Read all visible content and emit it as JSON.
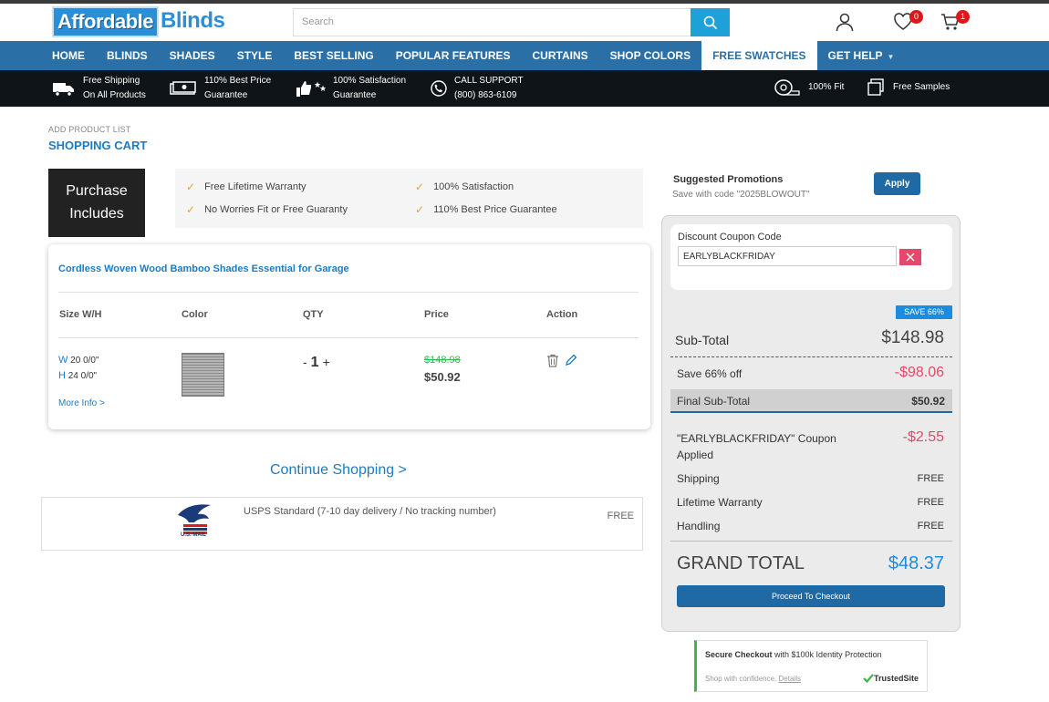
{
  "header": {
    "logo_part1": "Affordable",
    "logo_part2": "Blinds",
    "search_placeholder": "Search",
    "wishlist_count": "0",
    "cart_count": "1"
  },
  "nav": {
    "items": [
      "HOME",
      "BLINDS",
      "SHADES",
      "STYLE",
      "BEST SELLING",
      "POPULAR FEATURES",
      "CURTAINS",
      "SHOP COLORS",
      "FREE SWATCHES",
      "GET HELP"
    ],
    "active": "FREE SWATCHES"
  },
  "benefits": {
    "shipping_1": "Free Shipping",
    "shipping_2": "On All Products",
    "price_1": "110% Best Price",
    "price_2": "Guarantee",
    "satisfaction_1": "100% Satisfaction",
    "satisfaction_2": "Guarantee",
    "support_1": "CALL SUPPORT",
    "support_2": "(800) 863-6109",
    "fit": "100% Fit",
    "samples": "Free Samples"
  },
  "page": {
    "breadcrumb": "ADD PRODUCT LIST",
    "title": "SHOPPING CART",
    "purchase_includes": "Purchase Includes",
    "features": [
      "Free Lifetime Warranty",
      "100% Satisfaction",
      "No Worries Fit or Free Guaranty",
      "110% Best Price Guarantee"
    ]
  },
  "cart": {
    "product_name": "Cordless Woven Wood Bamboo Shades Essential for Garage",
    "headers": [
      "Size W/H",
      "Color",
      "QTY",
      "Price",
      "Action"
    ],
    "width_label": "W",
    "width_value": "20 0/0\"",
    "height_label": "H",
    "height_value": "24 0/0\"",
    "more_info": "More Info >",
    "qty_minus": "-",
    "qty": "1",
    "qty_plus": "+",
    "old_price": "$148.98",
    "new_price": "$50.92"
  },
  "continue_shopping": "Continue Shopping >",
  "shipping_option": {
    "label": "USPS Standard (7-10 day delivery / No tracking number)",
    "price": "FREE",
    "logo_text": "U.S. MAIL"
  },
  "promo": {
    "title": "Suggested Promotions",
    "subtitle": "Save with code \"2025BLOWOUT\"",
    "apply": "Apply"
  },
  "summary": {
    "coupon_label": "Discount Coupon Code",
    "coupon_value": "EARLYBLACKFRIDAY",
    "save_badge": "SAVE 66%",
    "subtotal_label": "Sub-Total",
    "subtotal": "$148.98",
    "save_label": "Save 66% off",
    "save_value": "-$98.06",
    "final_label": "Final Sub-Total",
    "final_value": "$50.92",
    "coupon_applied_1": "\"EARLYBLACKFRIDAY\" Coupon",
    "coupon_applied_2": "Applied",
    "coupon_discount": "-$2.55",
    "shipping_label": "Shipping",
    "shipping_value": "FREE",
    "warranty_label": "Lifetime Warranty",
    "warranty_value": "FREE",
    "handling_label": "Handling",
    "handling_value": "FREE",
    "grand_label": "GRAND TOTAL",
    "grand_value": "$48.37",
    "checkout": "Proceed To Checkout"
  },
  "trust": {
    "title_bold": "Secure Checkout",
    "title_rest": " with $100k Identity Protection",
    "sub": "Shop with confidence.",
    "details": "Details",
    "brand": "TrustedSite"
  },
  "colors": {
    "accent": "#2a6fa6",
    "link": "#1b7cc4",
    "discount": "#e5486a",
    "old_price": "#2bbf4a"
  }
}
